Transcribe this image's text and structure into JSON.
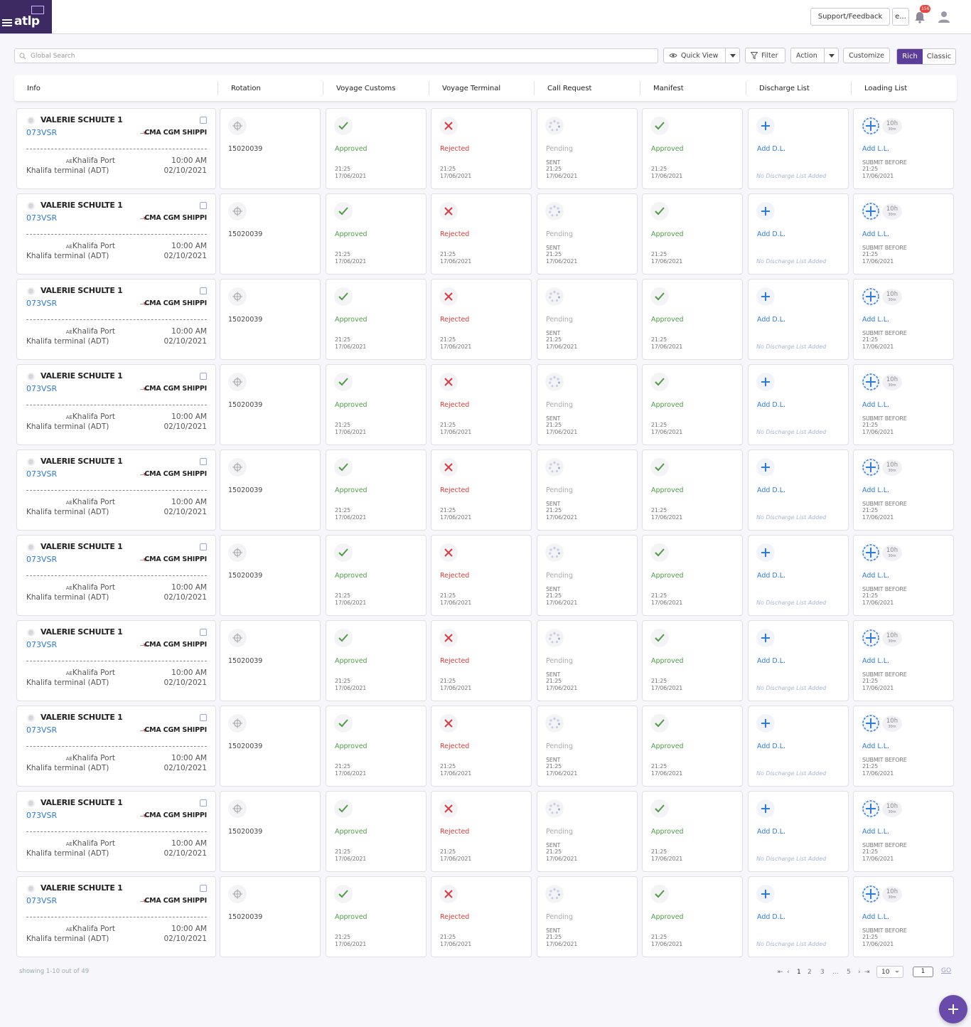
{
  "header": {
    "logo_text": "atlp",
    "support_label": "Support/Feedback",
    "lang_label": "e...",
    "notification_count": "156"
  },
  "toolbar": {
    "search_placeholder": "Global Search",
    "quick_view_label": "Quick View",
    "filter_label": "Filter",
    "action_label": "Action",
    "customize_label": "Customize",
    "view_rich_label": "Rich",
    "view_classic_label": "Classic"
  },
  "columns": [
    "Info",
    "Rotation",
    "Voyage Customs",
    "Voyage Terminal",
    "Call Request",
    "Manifest",
    "Discharge List",
    "Loading List"
  ],
  "rows": [
    {
      "vessel": "VALERIE SCHULTE 1",
      "code": "073VSR",
      "agent": "CMA CGM SHIPPI",
      "country": "AE",
      "port": "Khalifa Port",
      "terminal": "Khalifa terminal (ADT)",
      "time": "10:00 AM",
      "date": "02/10/2021",
      "rotation": "15020039",
      "customs_status": "Approved",
      "customs_time": "21:25",
      "customs_date": "17/06/2021",
      "terminal_status": "Rejected",
      "terminal_time": "21:25",
      "terminal_date": "17/06/2021",
      "call_status": "Pending",
      "call_prefix": "SENT",
      "call_time": "21:25",
      "call_date": "17/06/2021",
      "manifest_status": "Approved",
      "manifest_time": "21:25",
      "manifest_date": "17/06/2021",
      "dl_action": "Add D.L.",
      "dl_note": "No Discharge List Added",
      "ll_action": "Add L.L.",
      "ll_hours": "10h",
      "ll_mins": "30m",
      "ll_prefix": "SUBMIT BEFORE",
      "ll_time": "21:25",
      "ll_date": "17/06/2021"
    },
    {
      "vessel": "VALERIE SCHULTE 1",
      "code": "073VSR",
      "agent": "CMA CGM SHIPPI",
      "country": "AE",
      "port": "Khalifa Port",
      "terminal": "Khalifa terminal (ADT)",
      "time": "10:00 AM",
      "date": "02/10/2021",
      "rotation": "15020039",
      "customs_status": "Approved",
      "customs_time": "21:25",
      "customs_date": "17/06/2021",
      "terminal_status": "Rejected",
      "terminal_time": "21:25",
      "terminal_date": "17/06/2021",
      "call_status": "Pending",
      "call_prefix": "SENT",
      "call_time": "21:25",
      "call_date": "17/06/2021",
      "manifest_status": "Approved",
      "manifest_time": "21:25",
      "manifest_date": "17/06/2021",
      "dl_action": "Add D.L.",
      "dl_note": "No Discharge List Added",
      "ll_action": "Add L.L.",
      "ll_hours": "10h",
      "ll_mins": "30m",
      "ll_prefix": "SUBMIT BEFORE",
      "ll_time": "21:25",
      "ll_date": "17/06/2021"
    },
    {
      "vessel": "VALERIE SCHULTE 1",
      "code": "073VSR",
      "agent": "CMA CGM SHIPPI",
      "country": "AE",
      "port": "Khalifa Port",
      "terminal": "Khalifa terminal (ADT)",
      "time": "10:00 AM",
      "date": "02/10/2021",
      "rotation": "15020039",
      "customs_status": "Approved",
      "customs_time": "21:25",
      "customs_date": "17/06/2021",
      "terminal_status": "Rejected",
      "terminal_time": "21:25",
      "terminal_date": "17/06/2021",
      "call_status": "Pending",
      "call_prefix": "SENT",
      "call_time": "21:25",
      "call_date": "17/06/2021",
      "manifest_status": "Approved",
      "manifest_time": "21:25",
      "manifest_date": "17/06/2021",
      "dl_action": "Add D.L.",
      "dl_note": "No Discharge List Added",
      "ll_action": "Add L.L.",
      "ll_hours": "10h",
      "ll_mins": "30m",
      "ll_prefix": "SUBMIT BEFORE",
      "ll_time": "21:25",
      "ll_date": "17/06/2021"
    },
    {
      "vessel": "VALERIE SCHULTE 1",
      "code": "073VSR",
      "agent": "CMA CGM SHIPPI",
      "country": "AE",
      "port": "Khalifa Port",
      "terminal": "Khalifa terminal (ADT)",
      "time": "10:00 AM",
      "date": "02/10/2021",
      "rotation": "15020039",
      "customs_status": "Approved",
      "customs_time": "21:25",
      "customs_date": "17/06/2021",
      "terminal_status": "Rejected",
      "terminal_time": "21:25",
      "terminal_date": "17/06/2021",
      "call_status": "Pending",
      "call_prefix": "SENT",
      "call_time": "21:25",
      "call_date": "17/06/2021",
      "manifest_status": "Approved",
      "manifest_time": "21:25",
      "manifest_date": "17/06/2021",
      "dl_action": "Add D.L.",
      "dl_note": "No Discharge List Added",
      "ll_action": "Add L.L.",
      "ll_hours": "10h",
      "ll_mins": "30m",
      "ll_prefix": "SUBMIT BEFORE",
      "ll_time": "21:25",
      "ll_date": "17/06/2021"
    },
    {
      "vessel": "VALERIE SCHULTE 1",
      "code": "073VSR",
      "agent": "CMA CGM SHIPPI",
      "country": "AE",
      "port": "Khalifa Port",
      "terminal": "Khalifa terminal (ADT)",
      "time": "10:00 AM",
      "date": "02/10/2021",
      "rotation": "15020039",
      "customs_status": "Approved",
      "customs_time": "21:25",
      "customs_date": "17/06/2021",
      "terminal_status": "Rejected",
      "terminal_time": "21:25",
      "terminal_date": "17/06/2021",
      "call_status": "Pending",
      "call_prefix": "SENT",
      "call_time": "21:25",
      "call_date": "17/06/2021",
      "manifest_status": "Approved",
      "manifest_time": "21:25",
      "manifest_date": "17/06/2021",
      "dl_action": "Add D.L.",
      "dl_note": "No Discharge List Added",
      "ll_action": "Add L.L.",
      "ll_hours": "10h",
      "ll_mins": "30m",
      "ll_prefix": "SUBMIT BEFORE",
      "ll_time": "21:25",
      "ll_date": "17/06/2021"
    },
    {
      "vessel": "VALERIE SCHULTE 1",
      "code": "073VSR",
      "agent": "CMA CGM SHIPPI",
      "country": "AE",
      "port": "Khalifa Port",
      "terminal": "Khalifa terminal (ADT)",
      "time": "10:00 AM",
      "date": "02/10/2021",
      "rotation": "15020039",
      "customs_status": "Approved",
      "customs_time": "21:25",
      "customs_date": "17/06/2021",
      "terminal_status": "Rejected",
      "terminal_time": "21:25",
      "terminal_date": "17/06/2021",
      "call_status": "Pending",
      "call_prefix": "SENT",
      "call_time": "21:25",
      "call_date": "17/06/2021",
      "manifest_status": "Approved",
      "manifest_time": "21:25",
      "manifest_date": "17/06/2021",
      "dl_action": "Add D.L.",
      "dl_note": "No Discharge List Added",
      "ll_action": "Add L.L.",
      "ll_hours": "10h",
      "ll_mins": "30m",
      "ll_prefix": "SUBMIT BEFORE",
      "ll_time": "21:25",
      "ll_date": "17/06/2021"
    },
    {
      "vessel": "VALERIE SCHULTE 1",
      "code": "073VSR",
      "agent": "CMA CGM SHIPPI",
      "country": "AE",
      "port": "Khalifa Port",
      "terminal": "Khalifa terminal (ADT)",
      "time": "10:00 AM",
      "date": "02/10/2021",
      "rotation": "15020039",
      "customs_status": "Approved",
      "customs_time": "21:25",
      "customs_date": "17/06/2021",
      "terminal_status": "Rejected",
      "terminal_time": "21:25",
      "terminal_date": "17/06/2021",
      "call_status": "Pending",
      "call_prefix": "SENT",
      "call_time": "21:25",
      "call_date": "17/06/2021",
      "manifest_status": "Approved",
      "manifest_time": "21:25",
      "manifest_date": "17/06/2021",
      "dl_action": "Add D.L.",
      "dl_note": "No Discharge List Added",
      "ll_action": "Add L.L.",
      "ll_hours": "10h",
      "ll_mins": "30m",
      "ll_prefix": "SUBMIT BEFORE",
      "ll_time": "21:25",
      "ll_date": "17/06/2021"
    },
    {
      "vessel": "VALERIE SCHULTE 1",
      "code": "073VSR",
      "agent": "CMA CGM SHIPPI",
      "country": "AE",
      "port": "Khalifa Port",
      "terminal": "Khalifa terminal (ADT)",
      "time": "10:00 AM",
      "date": "02/10/2021",
      "rotation": "15020039",
      "customs_status": "Approved",
      "customs_time": "21:25",
      "customs_date": "17/06/2021",
      "terminal_status": "Rejected",
      "terminal_time": "21:25",
      "terminal_date": "17/06/2021",
      "call_status": "Pending",
      "call_prefix": "SENT",
      "call_time": "21:25",
      "call_date": "17/06/2021",
      "manifest_status": "Approved",
      "manifest_time": "21:25",
      "manifest_date": "17/06/2021",
      "dl_action": "Add D.L.",
      "dl_note": "No Discharge List Added",
      "ll_action": "Add L.L.",
      "ll_hours": "10h",
      "ll_mins": "30m",
      "ll_prefix": "SUBMIT BEFORE",
      "ll_time": "21:25",
      "ll_date": "17/06/2021"
    },
    {
      "vessel": "VALERIE SCHULTE 1",
      "code": "073VSR",
      "agent": "CMA CGM SHIPPI",
      "country": "AE",
      "port": "Khalifa Port",
      "terminal": "Khalifa terminal (ADT)",
      "time": "10:00 AM",
      "date": "02/10/2021",
      "rotation": "15020039",
      "customs_status": "Approved",
      "customs_time": "21:25",
      "customs_date": "17/06/2021",
      "terminal_status": "Rejected",
      "terminal_time": "21:25",
      "terminal_date": "17/06/2021",
      "call_status": "Pending",
      "call_prefix": "SENT",
      "call_time": "21:25",
      "call_date": "17/06/2021",
      "manifest_status": "Approved",
      "manifest_time": "21:25",
      "manifest_date": "17/06/2021",
      "dl_action": "Add D.L.",
      "dl_note": "No Discharge List Added",
      "ll_action": "Add L.L.",
      "ll_hours": "10h",
      "ll_mins": "30m",
      "ll_prefix": "SUBMIT BEFORE",
      "ll_time": "21:25",
      "ll_date": "17/06/2021"
    },
    {
      "vessel": "VALERIE SCHULTE 1",
      "code": "073VSR",
      "agent": "CMA CGM SHIPPI",
      "country": "AE",
      "port": "Khalifa Port",
      "terminal": "Khalifa terminal (ADT)",
      "time": "10:00 AM",
      "date": "02/10/2021",
      "rotation": "15020039",
      "customs_status": "Approved",
      "customs_time": "21:25",
      "customs_date": "17/06/2021",
      "terminal_status": "Rejected",
      "terminal_time": "21:25",
      "terminal_date": "17/06/2021",
      "call_status": "Pending",
      "call_prefix": "SENT",
      "call_time": "21:25",
      "call_date": "17/06/2021",
      "manifest_status": "Approved",
      "manifest_time": "21:25",
      "manifest_date": "17/06/2021",
      "dl_action": "Add D.L.",
      "dl_note": "No Discharge List Added",
      "ll_action": "Add L.L.",
      "ll_hours": "10h",
      "ll_mins": "30m",
      "ll_prefix": "SUBMIT BEFORE",
      "ll_time": "21:25",
      "ll_date": "17/06/2021"
    }
  ],
  "footer": {
    "showing_text": "showing 1-10 out of 49",
    "pages": [
      "1",
      "2",
      "3",
      "...",
      "5"
    ],
    "page_size": "10",
    "current_page": "1",
    "go_label": "GO"
  },
  "colors": {
    "brand": "#3e2a63",
    "accent": "#5c3d99",
    "approved": "#4f9c46",
    "rejected": "#d93a3a",
    "link": "#2e7bd9"
  }
}
